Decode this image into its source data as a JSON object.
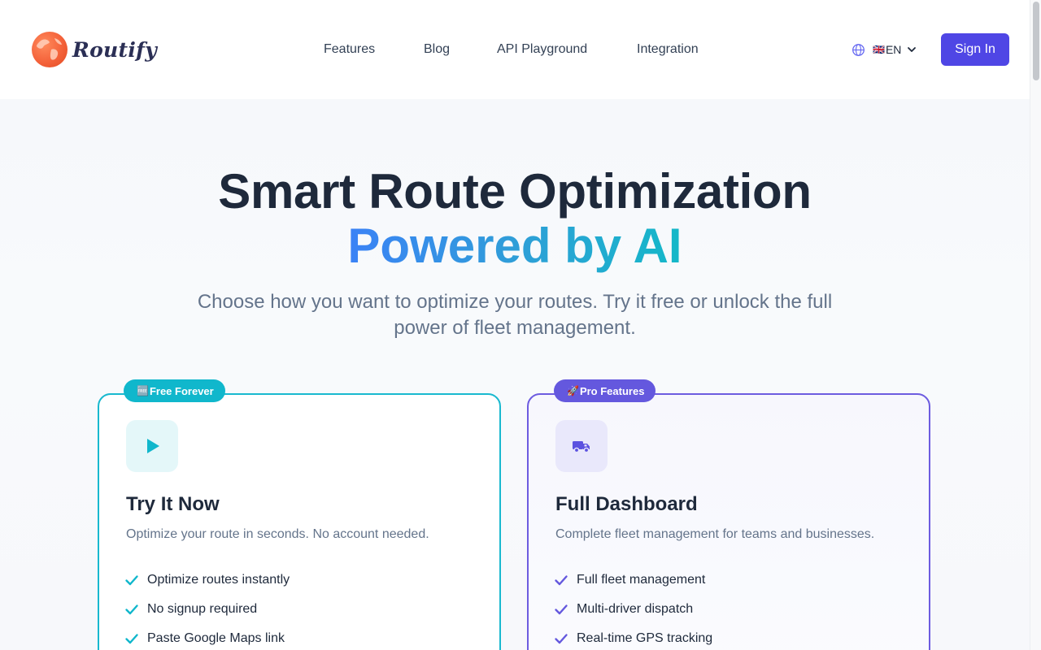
{
  "brand": {
    "name": "Routify"
  },
  "nav": {
    "items": [
      {
        "label": "Features"
      },
      {
        "label": "Blog"
      },
      {
        "label": "API Playground"
      },
      {
        "label": "Integration"
      }
    ],
    "language": {
      "flag": "🇬🇧",
      "code": "EN"
    },
    "signin_label": "Sign In"
  },
  "hero": {
    "title_line1": "Smart Route Optimization",
    "title_line2": "Powered by AI",
    "subtitle": "Choose how you want to optimize your routes. Try it free or unlock the full power of fleet management."
  },
  "cards": [
    {
      "badge_emoji": "🆓",
      "badge": "Free Forever",
      "icon": "play-icon",
      "title": "Try It Now",
      "description": "Optimize your route in seconds. No account needed.",
      "features": [
        "Optimize routes instantly",
        "No signup required",
        "Paste Google Maps link"
      ]
    },
    {
      "badge_emoji": "🚀",
      "badge": "Pro Features",
      "icon": "truck-icon",
      "title": "Full Dashboard",
      "description": "Complete fleet management for teams and businesses.",
      "features": [
        "Full fleet management",
        "Multi-driver dispatch",
        "Real-time GPS tracking"
      ]
    }
  ],
  "colors": {
    "primary": "#4f46e5",
    "free_accent": "#10b7cc",
    "pro_accent": "#6458de",
    "heading": "#1e293b",
    "muted": "#64748b"
  }
}
